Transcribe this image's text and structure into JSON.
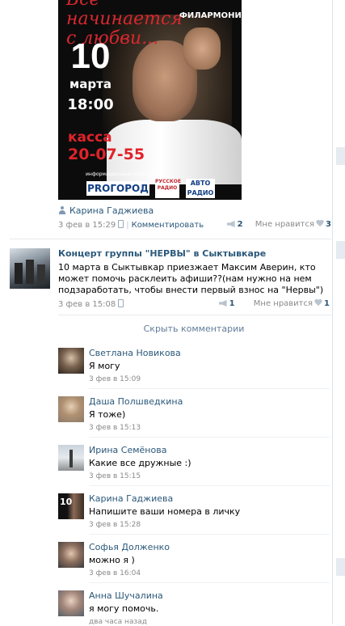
{
  "post1": {
    "poster": {
      "cursive_line1": "Все начинается",
      "cursive_line2": "с любви...",
      "venue": "ФИЛАРМОНИЯ",
      "day": "10",
      "month": "марта",
      "time": "18:00",
      "kassa_label": "касса",
      "phone": "20-07-55",
      "partners_label": "информационные партнеры:",
      "logo1": "PROГОРОД",
      "logo2": "РУССКОЕ РАДИО",
      "logo3": "АВТО РАДИО"
    },
    "author": "Карина Гаджиева",
    "date": "3 фев в 15:29",
    "comment_link": "Комментировать",
    "shares": "2",
    "like_label": "Мне нравится",
    "likes": "3"
  },
  "post2": {
    "title": "Концерт группы \"НЕРВЫ\" в Сыктывкаре",
    "text": "10 марта в Сыктывкар приезжает Максим Аверин, кто может помочь расклеить афиши??(нам нужно на нем подзаработать, чтобы внести первый взнос на \"Нервы\")",
    "date": "3 фев в 15:08",
    "shares": "1",
    "like_label": "Мне нравится",
    "likes": "1",
    "hide_comments": "Скрыть комментарии"
  },
  "comments": [
    {
      "name": "Светлана Новикова",
      "text": "Я могу",
      "time": "3 фев в 15:09"
    },
    {
      "name": "Даша Полшведкина",
      "text": "Я тоже)",
      "time": "3 фев в 15:13"
    },
    {
      "name": "Ирина Семёнова",
      "text": "Какие все дружные :)",
      "time": "3 фев в 15:15"
    },
    {
      "name": "Карина Гаджиева",
      "text": "Напишите ваши номера в личку",
      "time": "3 фев в 15:28"
    },
    {
      "name": "Софья Долженко",
      "text": "можно я )",
      "time": "3 фев в 16:04"
    },
    {
      "name": "Анна Шучалина",
      "text": "я могу помочь.",
      "time": "два часа назад"
    }
  ],
  "colors": {
    "link": "#2b587a",
    "meta": "#8a8a8a",
    "poster_red": "#d8282f"
  }
}
